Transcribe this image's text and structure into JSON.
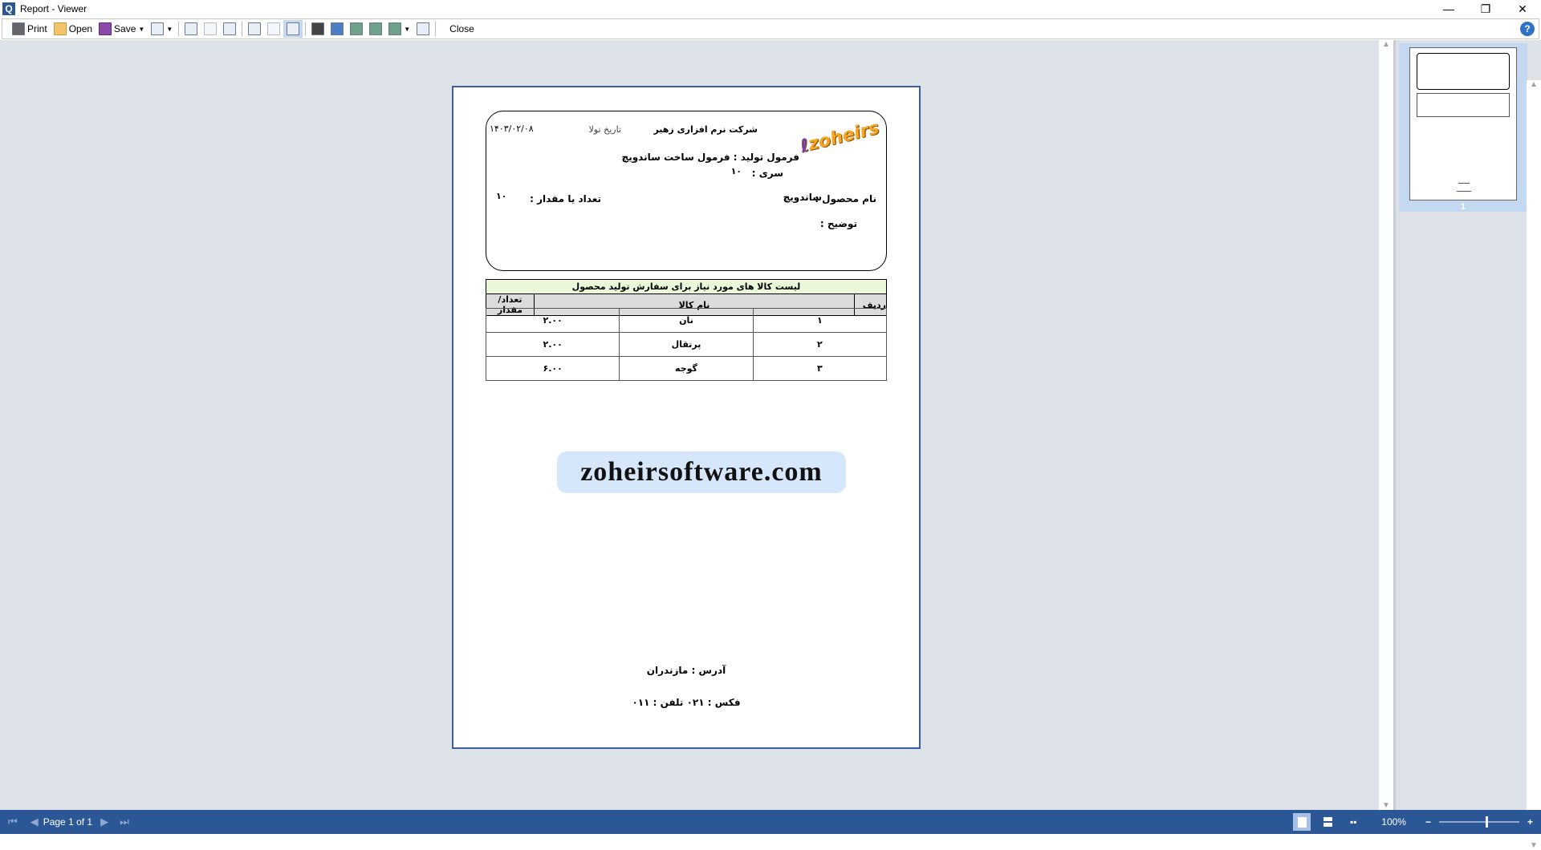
{
  "window": {
    "title": "Report - Viewer",
    "minimize": "—",
    "restore": "❐",
    "close": "✕"
  },
  "toolbar": {
    "print": "Print",
    "open": "Open",
    "save": "Save",
    "close": "Close",
    "help": "?"
  },
  "report": {
    "company": "شرکت نرم افزاری زهیر",
    "date_label": "تاریخ تولا",
    "date": "۱۴۰۳/۰۲/۰۸",
    "logo_text": "zoheirs",
    "formula": "فرمول تولید : فرمول ساخت ساندویچ",
    "series_label": "سری :",
    "series": "۱۰",
    "product_label": "نام محصول :",
    "product": "ساندویچ",
    "qty_label": "تعداد یا مقدار :",
    "qty": "۱۰",
    "desc_label": "توضیح :",
    "table_title": "لیست کالا های مورد نیاز برای سفارش تولید محصول",
    "columns": [
      "ردیف",
      "نام کالا",
      "تعداد/مقدار"
    ],
    "rows": [
      [
        "۱",
        "نان",
        "۲.۰۰"
      ],
      [
        "۲",
        "پرتقال",
        "۲.۰۰"
      ],
      [
        "۳",
        "گوجه",
        "۶.۰۰"
      ]
    ],
    "website": "zoheirsoftware.com",
    "address": "آدرس :  مازندران",
    "contact": "فکس : ۰۲۱ تلفن : ۰۱۱"
  },
  "thumbnail": {
    "page_number": "1"
  },
  "status": {
    "page": "Page 1 of 1",
    "zoom": "100%",
    "zoom_percent": 100,
    "minus": "−",
    "plus": "+"
  },
  "colors": {
    "accent": "#2b5797",
    "page_border": "#3a5da8",
    "table_title_bg": "#e8f8d8",
    "website_bg": "#d6e6fb"
  }
}
